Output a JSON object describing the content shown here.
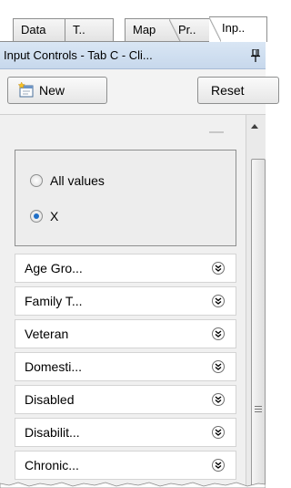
{
  "tabs": [
    {
      "label": "Data"
    },
    {
      "label": "T.."
    },
    {
      "label": "Map"
    },
    {
      "label": "Pr.."
    },
    {
      "label": "Inp.."
    }
  ],
  "panel_title": "Input Controls - Tab C - Cli...",
  "toolbar": {
    "new_label": "New",
    "reset_label": "Reset"
  },
  "radio_options": [
    {
      "label": "All values",
      "checked": false
    },
    {
      "label": "X",
      "checked": true
    }
  ],
  "filters": [
    {
      "label": "Age Gro..."
    },
    {
      "label": "Family T..."
    },
    {
      "label": "Veteran"
    },
    {
      "label": "Domesti..."
    },
    {
      "label": "Disabled"
    },
    {
      "label": "Disabilit..."
    },
    {
      "label": "Chronic..."
    }
  ],
  "icons": {
    "pin": "pin-icon",
    "new": "new-document-icon",
    "expand": "double-chevron-down-icon"
  },
  "colors": {
    "title_bar": "#c7d8ec",
    "radio_selected": "#1f6fc7",
    "panel_bg": "#f0f0f0"
  }
}
